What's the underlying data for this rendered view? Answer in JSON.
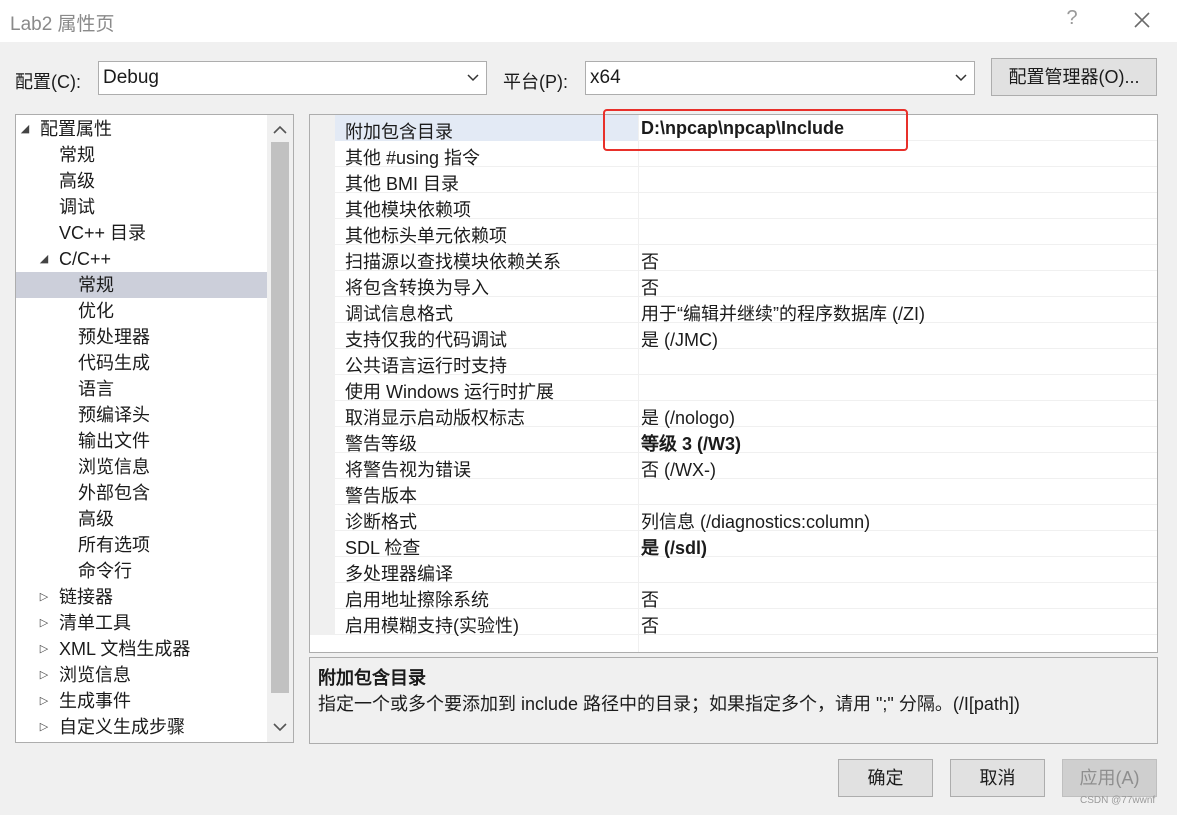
{
  "window": {
    "title": "Lab2 属性页",
    "help_label": "?",
    "close_icon": "close-icon"
  },
  "toolbar": {
    "config_label": "配置(C):",
    "config_value": "Debug",
    "platform_label": "平台(P):",
    "platform_value": "x64",
    "config_manager_button": "配置管理器(O)..."
  },
  "tree": {
    "nodes": [
      {
        "label": "配置属性",
        "expander": "◢",
        "level": 0
      },
      {
        "label": "常规",
        "expander": "",
        "level": 1
      },
      {
        "label": "高级",
        "expander": "",
        "level": 1
      },
      {
        "label": "调试",
        "expander": "",
        "level": 1
      },
      {
        "label": "VC++ 目录",
        "expander": "",
        "level": 1
      },
      {
        "label": "C/C++",
        "expander": "◢",
        "level": 1
      },
      {
        "label": "常规",
        "expander": "",
        "level": 2,
        "selected": true
      },
      {
        "label": "优化",
        "expander": "",
        "level": 2
      },
      {
        "label": "预处理器",
        "expander": "",
        "level": 2
      },
      {
        "label": "代码生成",
        "expander": "",
        "level": 2
      },
      {
        "label": "语言",
        "expander": "",
        "level": 2
      },
      {
        "label": "预编译头",
        "expander": "",
        "level": 2
      },
      {
        "label": "输出文件",
        "expander": "",
        "level": 2
      },
      {
        "label": "浏览信息",
        "expander": "",
        "level": 2
      },
      {
        "label": "外部包含",
        "expander": "",
        "level": 2
      },
      {
        "label": "高级",
        "expander": "",
        "level": 2
      },
      {
        "label": "所有选项",
        "expander": "",
        "level": 2
      },
      {
        "label": "命令行",
        "expander": "",
        "level": 2
      },
      {
        "label": "链接器",
        "expander": "▷",
        "level": 1
      },
      {
        "label": "清单工具",
        "expander": "▷",
        "level": 1
      },
      {
        "label": "XML 文档生成器",
        "expander": "▷",
        "level": 1
      },
      {
        "label": "浏览信息",
        "expander": "▷",
        "level": 1
      },
      {
        "label": "生成事件",
        "expander": "▷",
        "level": 1
      },
      {
        "label": "自定义生成步骤",
        "expander": "▷",
        "level": 1
      }
    ]
  },
  "properties": [
    {
      "name": "附加包含目录",
      "value": "D:\\npcap\\npcap\\Include",
      "bold": true,
      "selected": true
    },
    {
      "name": "其他 #using 指令",
      "value": "",
      "bold": false
    },
    {
      "name": "其他 BMI 目录",
      "value": "",
      "bold": false
    },
    {
      "name": "其他模块依赖项",
      "value": "",
      "bold": false
    },
    {
      "name": "其他标头单元依赖项",
      "value": "",
      "bold": false
    },
    {
      "name": "扫描源以查找模块依赖关系",
      "value": "否",
      "bold": false
    },
    {
      "name": "将包含转换为导入",
      "value": "否",
      "bold": false
    },
    {
      "name": "调试信息格式",
      "value": "用于“编辑并继续”的程序数据库 (/ZI)",
      "bold": false
    },
    {
      "name": "支持仅我的代码调试",
      "value": "是 (/JMC)",
      "bold": false
    },
    {
      "name": "公共语言运行时支持",
      "value": "",
      "bold": false
    },
    {
      "name": "使用 Windows 运行时扩展",
      "value": "",
      "bold": false
    },
    {
      "name": "取消显示启动版权标志",
      "value": "是 (/nologo)",
      "bold": false
    },
    {
      "name": "警告等级",
      "value": "等级 3 (/W3)",
      "bold": true
    },
    {
      "name": "将警告视为错误",
      "value": "否 (/WX-)",
      "bold": false
    },
    {
      "name": "警告版本",
      "value": "",
      "bold": false
    },
    {
      "name": "诊断格式",
      "value": "列信息 (/diagnostics:column)",
      "bold": false
    },
    {
      "name": "SDL 检查",
      "value": "是 (/sdl)",
      "bold": true
    },
    {
      "name": "多处理器编译",
      "value": "",
      "bold": false
    },
    {
      "name": "启用地址擦除系统",
      "value": "否",
      "bold": false
    },
    {
      "name": "启用模糊支持(实验性)",
      "value": "否",
      "bold": false
    }
  ],
  "description": {
    "title": "附加包含目录",
    "text": "指定一个或多个要添加到 include 路径中的目录；如果指定多个，请用 \";\" 分隔。(/I[path])"
  },
  "footer": {
    "ok_label": "确定",
    "cancel_label": "取消",
    "apply_label": "应用(A)",
    "apply_enabled": false
  },
  "watermark": "CSDN @77wwnf",
  "colors": {
    "selection": "#cccfda",
    "highlight_box": "#e8302a",
    "window_bg": "#f0f0f0"
  }
}
